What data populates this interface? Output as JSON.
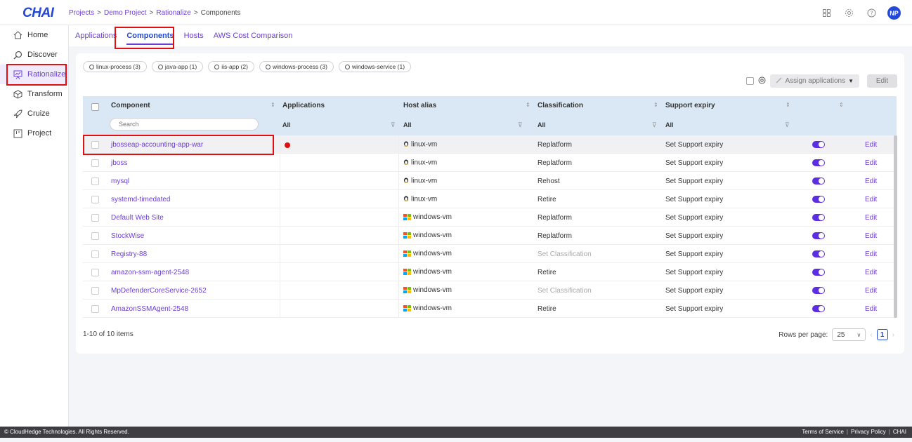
{
  "app": {
    "logo": "CHAI",
    "user_initials": "NP"
  },
  "breadcrumb": {
    "items": [
      "Projects",
      "Demo Project",
      "Rationalize",
      "Components"
    ],
    "separator": ">"
  },
  "sidebar": {
    "items": [
      {
        "label": "Home",
        "icon": "home-icon"
      },
      {
        "label": "Discover",
        "icon": "search-icon"
      },
      {
        "label": "Rationalize",
        "icon": "presentation-icon",
        "active": true
      },
      {
        "label": "Transform",
        "icon": "cube-icon"
      },
      {
        "label": "Cruize",
        "icon": "rocket-icon"
      },
      {
        "label": "Project",
        "icon": "board-icon"
      }
    ]
  },
  "tabs": [
    {
      "label": "Applications"
    },
    {
      "label": "Components",
      "active": true
    },
    {
      "label": "Hosts"
    },
    {
      "label": "AWS Cost Comparison"
    }
  ],
  "filters": [
    "linux-process (3)",
    "java-app (1)",
    "iis-app (2)",
    "windows-process (3)",
    "windows-service (1)"
  ],
  "toolbar": {
    "assign_label": "Assign applications",
    "edit_label": "Edit"
  },
  "table": {
    "headers": {
      "component": "Component",
      "applications": "Applications",
      "host_alias": "Host alias",
      "classification": "Classification",
      "support_expiry": "Support expiry"
    },
    "filter_value": "All",
    "search_placeholder": "Search",
    "rows": [
      {
        "component": "jbosseap-accounting-app-war",
        "has_app": true,
        "host": "linux-vm",
        "os": "linux",
        "classification": "Replatform",
        "support": "Set Support expiry",
        "edit": "Edit",
        "selected": true
      },
      {
        "component": "jboss",
        "host": "linux-vm",
        "os": "linux",
        "classification": "Replatform",
        "support": "Set Support expiry",
        "edit": "Edit"
      },
      {
        "component": "mysql",
        "host": "linux-vm",
        "os": "linux",
        "classification": "Rehost",
        "support": "Set Support expiry",
        "edit": "Edit"
      },
      {
        "component": "systemd-timedated",
        "host": "linux-vm",
        "os": "linux",
        "classification": "Retire",
        "support": "Set Support expiry",
        "edit": "Edit"
      },
      {
        "component": "Default Web Site",
        "host": "windows-vm",
        "os": "windows",
        "classification": "Replatform",
        "support": "Set Support expiry",
        "edit": "Edit"
      },
      {
        "component": "StockWise",
        "host": "windows-vm",
        "os": "windows",
        "classification": "Replatform",
        "support": "Set Support expiry",
        "edit": "Edit"
      },
      {
        "component": "Registry-88",
        "host": "windows-vm",
        "os": "windows",
        "classification": "Set Classification",
        "support": "Set Support expiry",
        "edit": "Edit",
        "muted": true
      },
      {
        "component": "amazon-ssm-agent-2548",
        "host": "windows-vm",
        "os": "windows",
        "classification": "Retire",
        "support": "Set Support expiry",
        "edit": "Edit"
      },
      {
        "component": "MpDefenderCoreService-2652",
        "host": "windows-vm",
        "os": "windows",
        "classification": "Set Classification",
        "support": "Set Support expiry",
        "edit": "Edit",
        "muted": true
      },
      {
        "component": "AmazonSSMAgent-2548",
        "host": "windows-vm",
        "os": "windows",
        "classification": "Retire",
        "support": "Set Support expiry",
        "edit": "Edit"
      }
    ]
  },
  "pagination": {
    "info": "1-10 of 10 items",
    "rows_label": "Rows per page:",
    "rows_value": "25",
    "page": "1"
  },
  "footer": {
    "copyright": "© CloudHedge Technologies. All Rights Reserved.",
    "links": [
      "Terms of Service",
      "Privacy Policy",
      "CHAI"
    ]
  },
  "colors": {
    "accent": "#6b3fd6",
    "brand": "#2448d8",
    "highlight": "#e01010",
    "header_bg": "#d9e8f4"
  }
}
